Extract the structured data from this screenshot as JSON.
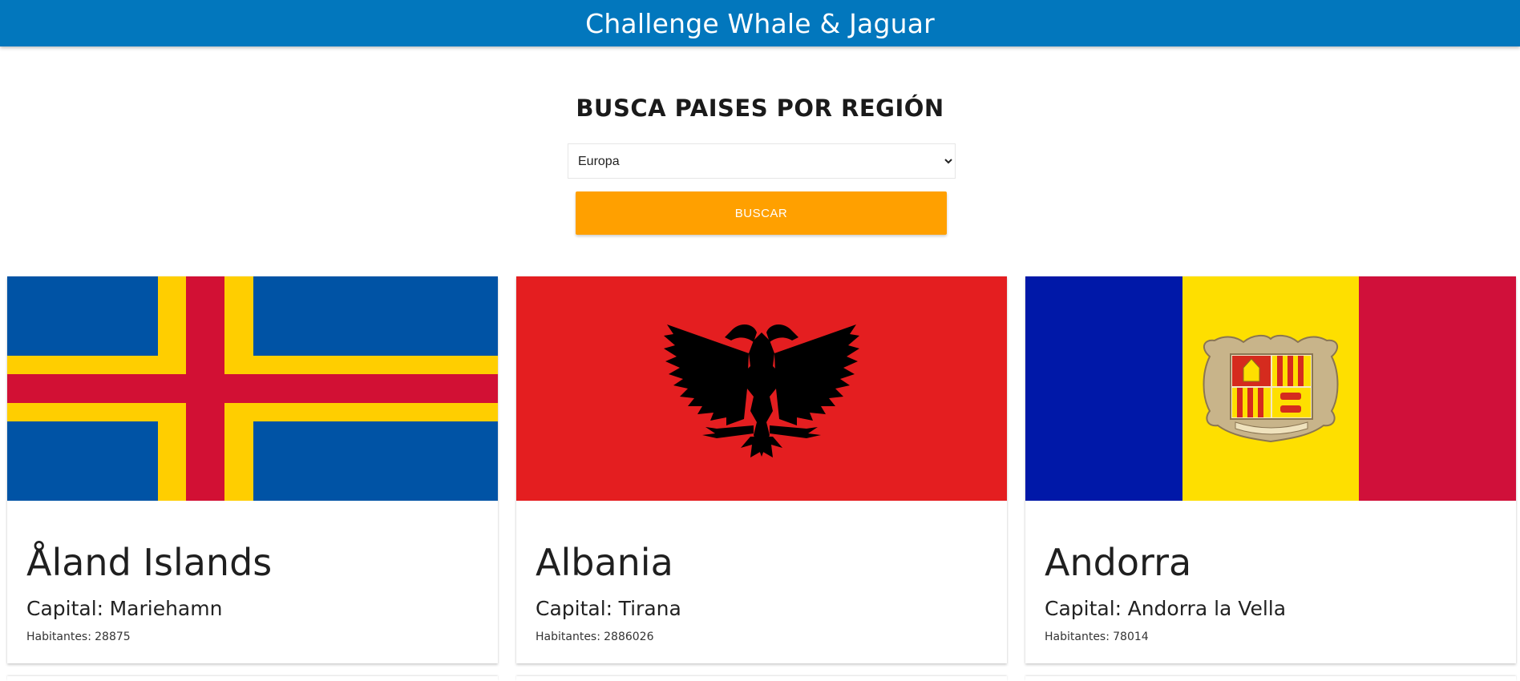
{
  "header": {
    "title": "Challenge Whale & Jaguar",
    "background": "#0277bd"
  },
  "search": {
    "heading": "BUSCA PAISES POR REGIÓN",
    "region_selected": "Europa",
    "button_label": "BUSCAR",
    "button_color": "#ffa000"
  },
  "countries": [
    {
      "name": "Åland Islands",
      "capital_label": "Capital:",
      "capital": "Mariehamn",
      "population_label": "Habitantes:",
      "population": "28875",
      "flag_icon": "aland-islands-flag",
      "flag_colors": [
        "#0053a5",
        "#ffce00",
        "#d21034"
      ]
    },
    {
      "name": "Albania",
      "capital_label": "Capital:",
      "capital": "Tirana",
      "population_label": "Habitantes:",
      "population": "2886026",
      "flag_icon": "albania-flag",
      "flag_colors": [
        "#e41e20",
        "#000000"
      ]
    },
    {
      "name": "Andorra",
      "capital_label": "Capital:",
      "capital": "Andorra la Vella",
      "population_label": "Habitantes:",
      "population": "78014",
      "flag_icon": "andorra-flag",
      "flag_colors": [
        "#0018a8",
        "#fedf00",
        "#d0103a"
      ]
    }
  ]
}
